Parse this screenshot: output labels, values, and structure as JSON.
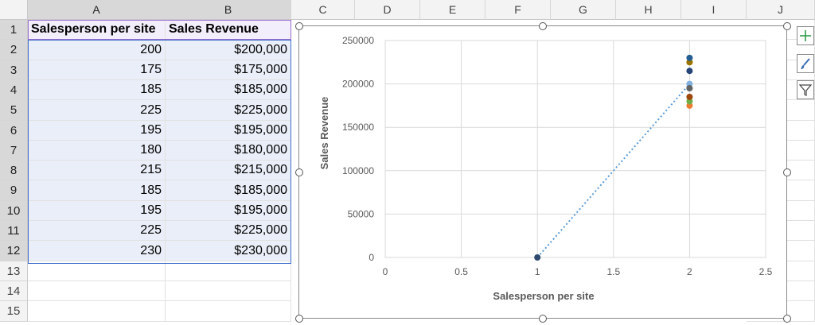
{
  "columns": [
    "A",
    "B",
    "C",
    "D",
    "E",
    "F",
    "G",
    "H",
    "I",
    "J"
  ],
  "rows": [
    "1",
    "2",
    "3",
    "4",
    "5",
    "6",
    "7",
    "8",
    "9",
    "10",
    "11",
    "12",
    "13",
    "14",
    "15"
  ],
  "table": {
    "headers": [
      "Salesperson per site",
      "Sales Revenue"
    ],
    "data": [
      [
        "200",
        "$200,000"
      ],
      [
        "175",
        "$175,000"
      ],
      [
        "185",
        "$185,000"
      ],
      [
        "225",
        "$225,000"
      ],
      [
        "195",
        "$195,000"
      ],
      [
        "180",
        "$180,000"
      ],
      [
        "215",
        "$215,000"
      ],
      [
        "185",
        "$185,000"
      ],
      [
        "195",
        "$195,000"
      ],
      [
        "225",
        "$225,000"
      ],
      [
        "230",
        "$230,000"
      ]
    ]
  },
  "chart_data": {
    "type": "scatter",
    "xlabel": "Salesperson per site",
    "ylabel": "Sales Revenue",
    "xlim": [
      0,
      2.5
    ],
    "ylim": [
      0,
      250000
    ],
    "xticks": [
      "0",
      "0.5",
      "1",
      "1.5",
      "2",
      "2.5"
    ],
    "yticks": [
      "0",
      "50000",
      "100000",
      "150000",
      "200000",
      "250000"
    ],
    "grid": true,
    "legend": "none",
    "points": [
      {
        "x": 1,
        "y": 0,
        "color": "#2e4a6e"
      },
      {
        "x": 2,
        "y": 200000,
        "color": "#7fb0e0"
      },
      {
        "x": 2,
        "y": 175000,
        "color": "#ed7d31"
      },
      {
        "x": 2,
        "y": 185000,
        "color": "#a5a5a5"
      },
      {
        "x": 2,
        "y": 225000,
        "color": "#c09000"
      },
      {
        "x": 2,
        "y": 195000,
        "color": "#5b9bd5"
      },
      {
        "x": 2,
        "y": 180000,
        "color": "#70ad47"
      },
      {
        "x": 2,
        "y": 215000,
        "color": "#264478"
      },
      {
        "x": 2,
        "y": 185000,
        "color": "#9e480e"
      },
      {
        "x": 2,
        "y": 195000,
        "color": "#636363"
      },
      {
        "x": 2,
        "y": 225000,
        "color": "#997300"
      },
      {
        "x": 2,
        "y": 230000,
        "color": "#255e91"
      }
    ],
    "trendline": {
      "from": [
        1,
        0
      ],
      "to": [
        2,
        200000
      ],
      "color": "#5b9bd5",
      "style": "dotted"
    }
  },
  "chart_tools": [
    "chart-elements-icon",
    "chart-styles-icon",
    "chart-filters-icon"
  ]
}
